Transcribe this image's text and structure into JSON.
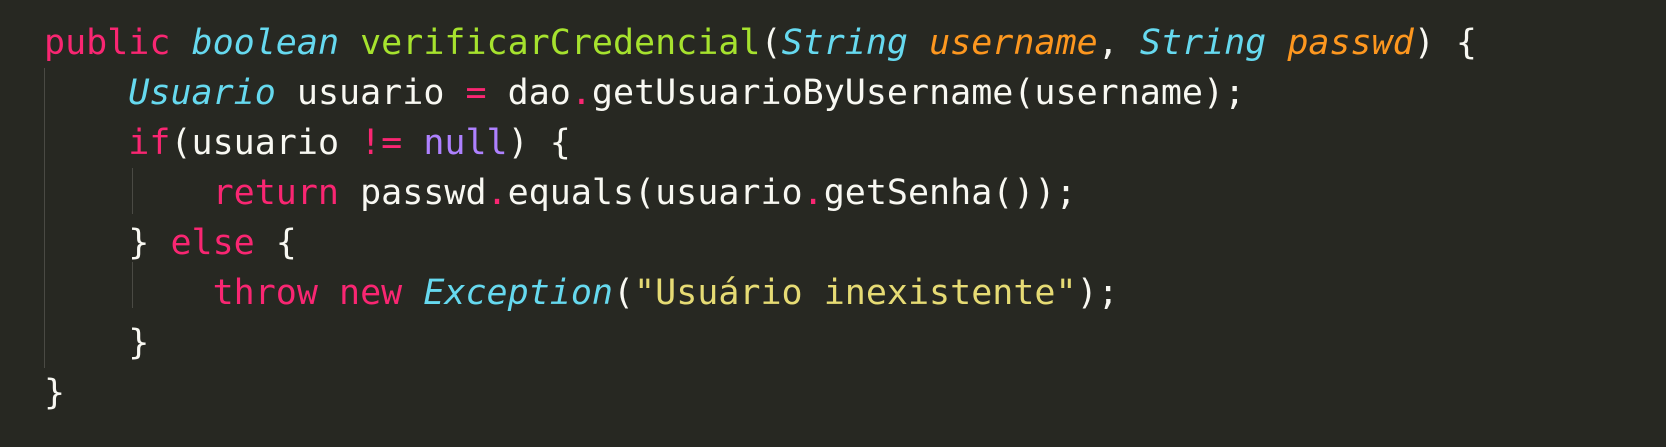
{
  "code": {
    "lines": [
      [
        {
          "t": "public",
          "c": "mod"
        },
        {
          "t": " ",
          "c": "plain"
        },
        {
          "t": "boolean",
          "c": "type"
        },
        {
          "t": " ",
          "c": "plain"
        },
        {
          "t": "verificarCredencial",
          "c": "fn"
        },
        {
          "t": "(",
          "c": "plain"
        },
        {
          "t": "String",
          "c": "type"
        },
        {
          "t": " ",
          "c": "plain"
        },
        {
          "t": "username",
          "c": "param"
        },
        {
          "t": ", ",
          "c": "plain"
        },
        {
          "t": "String",
          "c": "type"
        },
        {
          "t": " ",
          "c": "plain"
        },
        {
          "t": "passwd",
          "c": "param"
        },
        {
          "t": ") {",
          "c": "plain"
        }
      ],
      [
        {
          "t": "    ",
          "c": "plain"
        },
        {
          "t": "Usuario",
          "c": "type"
        },
        {
          "t": " usuario ",
          "c": "plain"
        },
        {
          "t": "=",
          "c": "op"
        },
        {
          "t": " dao",
          "c": "plain"
        },
        {
          "t": ".",
          "c": "op"
        },
        {
          "t": "getUsuarioByUsername(username);",
          "c": "plain"
        }
      ],
      [
        {
          "t": "    ",
          "c": "plain"
        },
        {
          "t": "if",
          "c": "kw"
        },
        {
          "t": "(usuario ",
          "c": "plain"
        },
        {
          "t": "!=",
          "c": "op"
        },
        {
          "t": " ",
          "c": "plain"
        },
        {
          "t": "null",
          "c": "const"
        },
        {
          "t": ") {",
          "c": "plain"
        }
      ],
      [
        {
          "t": "        ",
          "c": "plain"
        },
        {
          "t": "return",
          "c": "kw"
        },
        {
          "t": " passwd",
          "c": "plain"
        },
        {
          "t": ".",
          "c": "op"
        },
        {
          "t": "equals(usuario",
          "c": "plain"
        },
        {
          "t": ".",
          "c": "op"
        },
        {
          "t": "getSenha());",
          "c": "plain"
        }
      ],
      [
        {
          "t": "    } ",
          "c": "plain"
        },
        {
          "t": "else",
          "c": "kw"
        },
        {
          "t": " {",
          "c": "plain"
        }
      ],
      [
        {
          "t": "        ",
          "c": "plain"
        },
        {
          "t": "throw",
          "c": "kw"
        },
        {
          "t": " ",
          "c": "plain"
        },
        {
          "t": "new",
          "c": "kw"
        },
        {
          "t": " ",
          "c": "plain"
        },
        {
          "t": "Exception",
          "c": "type"
        },
        {
          "t": "(",
          "c": "plain"
        },
        {
          "t": "\"Usuário inexistente\"",
          "c": "str"
        },
        {
          "t": ");",
          "c": "plain"
        }
      ],
      [
        {
          "t": "    }",
          "c": "plain"
        }
      ],
      [
        {
          "t": "}",
          "c": "plain"
        }
      ]
    ]
  }
}
